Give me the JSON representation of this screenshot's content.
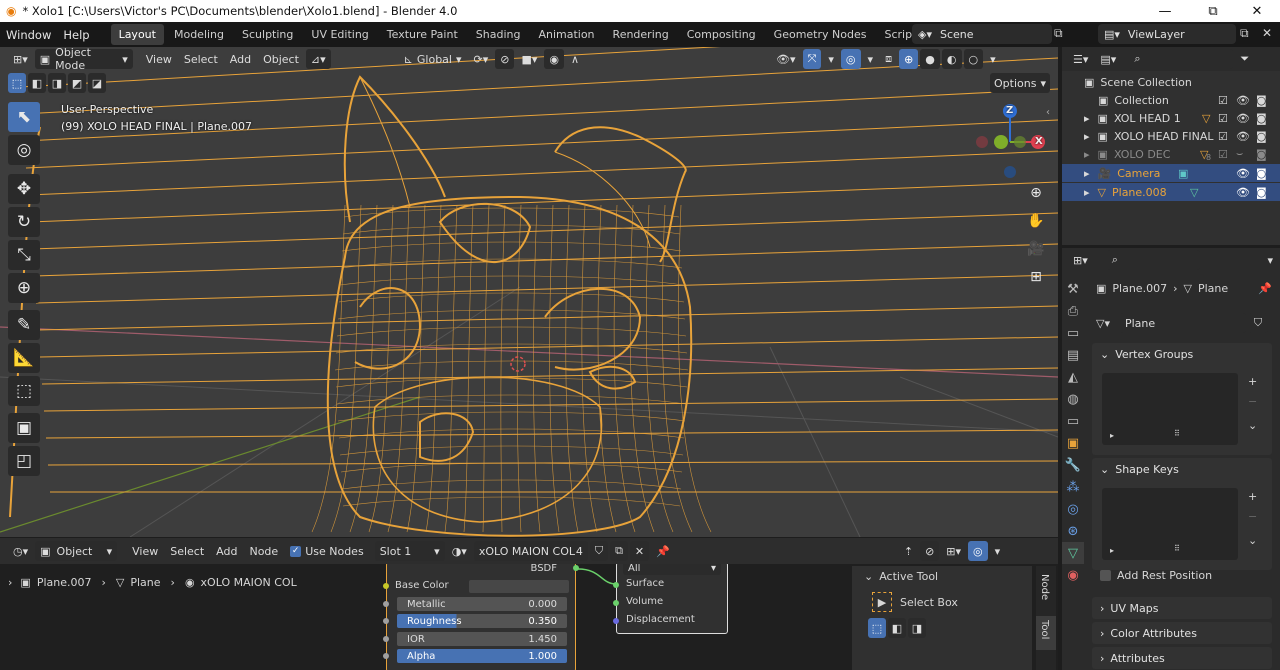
{
  "title": "* Xolo1 [C:\\Users\\Victor's PC\\Documents\\blender\\Xolo1.blend] - Blender 4.0",
  "window_controls": {
    "minimize": "—",
    "maximize": "⧉",
    "close": "✕"
  },
  "menu": {
    "items": [
      "Window",
      "Help"
    ]
  },
  "workspaces": [
    {
      "label": "Layout",
      "active": true
    },
    {
      "label": "Modeling"
    },
    {
      "label": "Sculpting"
    },
    {
      "label": "UV Editing"
    },
    {
      "label": "Texture Paint"
    },
    {
      "label": "Shading"
    },
    {
      "label": "Animation"
    },
    {
      "label": "Rendering"
    },
    {
      "label": "Compositing"
    },
    {
      "label": "Geometry Nodes"
    },
    {
      "label": "Scripting"
    }
  ],
  "add_workspace": "+",
  "scene": {
    "name": "Scene",
    "viewlayer": "ViewLayer"
  },
  "viewport_header": {
    "mode": "Object Mode",
    "menus": [
      "View",
      "Select",
      "Add",
      "Object"
    ],
    "transform_orientation": "Global",
    "options": "Options"
  },
  "viewport_info": {
    "perspective": "User Perspective",
    "object_line": "(99) XOLO HEAD FINAL  | Plane.007"
  },
  "gizmo": {
    "z": "Z",
    "x": "X"
  },
  "outliner": {
    "root": "Scene Collection",
    "rows": [
      {
        "label": "Collection",
        "indent": 1
      },
      {
        "label": "XOL HEAD 1",
        "indent": 2,
        "expand": "▸"
      },
      {
        "label": "XOLO HEAD FINAL",
        "indent": 2,
        "expand": "▸"
      },
      {
        "label": "XOLO DEC",
        "indent": 2,
        "expand": "▸",
        "dim": true,
        "badge": "8"
      },
      {
        "label": "Camera",
        "indent": 2,
        "expand": "▸",
        "selected": true
      },
      {
        "label": "Plane.008",
        "indent": 2,
        "expand": "▸",
        "selected": true
      }
    ]
  },
  "properties": {
    "breadcrumb_object": "Plane.007",
    "breadcrumb_data": "Plane",
    "data_name": "Plane",
    "panels": {
      "vertex_groups": "Vertex Groups",
      "shape_keys": "Shape Keys",
      "add_rest_position": "Add Rest Position",
      "uv_maps": "UV Maps",
      "color_attributes": "Color Attributes",
      "attributes": "Attributes"
    }
  },
  "node_header": {
    "type": "Object",
    "menus": [
      "View",
      "Select",
      "Add",
      "Node"
    ],
    "use_nodes": "Use Nodes",
    "slot": "Slot 1",
    "material": "xOLO MAION COL",
    "users": "4"
  },
  "node_breadcrumb": {
    "object": "Plane.007",
    "data": "Plane",
    "material": "xOLO MAION COL"
  },
  "bsdf_node": {
    "output_label": "BSDF",
    "base_color": "Base Color",
    "fields": [
      {
        "label": "Metallic",
        "value": "0.000",
        "highlight": false
      },
      {
        "label": "Roughness",
        "value": "0.350",
        "highlight": true
      },
      {
        "label": "IOR",
        "value": "1.450",
        "highlight": false
      },
      {
        "label": "Alpha",
        "value": "1.000",
        "highlight": true
      }
    ]
  },
  "output_node": {
    "target": "All",
    "inputs": [
      "Surface",
      "Volume",
      "Displacement"
    ]
  },
  "active_tool": {
    "header": "Active Tool",
    "tool": "Select Box"
  },
  "side_tabs": {
    "node": "Node",
    "tool": "Tool"
  },
  "colors": {
    "selection_blue": "#4772b3",
    "wire_orange": "#e8a33a",
    "viewport_bg": "#3d3d3d",
    "outliner_selected": "#334d80"
  }
}
